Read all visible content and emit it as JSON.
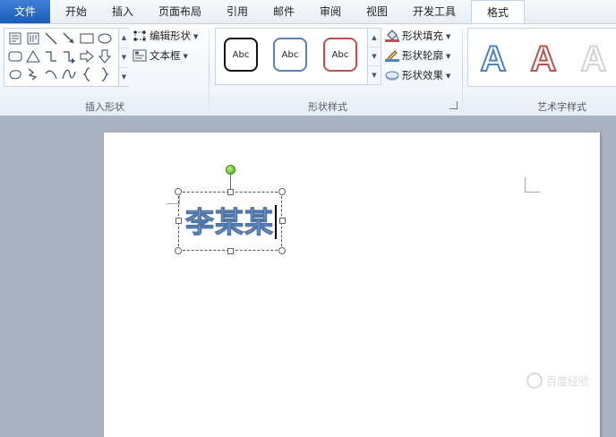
{
  "tabs": {
    "file": "文件",
    "items": [
      "开始",
      "插入",
      "页面布局",
      "引用",
      "邮件",
      "审阅",
      "视图",
      "开发工具"
    ],
    "active": "格式"
  },
  "ribbon": {
    "insert_shapes": {
      "label": "插入形状",
      "edit_shape": "编辑形状",
      "text_box": "文本框"
    },
    "shape_styles": {
      "label": "形状样式",
      "samples": [
        "Abc",
        "Abc",
        "Abc"
      ],
      "sample_colors": [
        "#111111",
        "#5b82b8",
        "#c0504d"
      ],
      "fill": "形状填充",
      "outline": "形状轮廓",
      "effects": "形状效果"
    },
    "wordart_styles": {
      "label": "艺术字样式",
      "samples": [
        "A",
        "A",
        "A"
      ],
      "sample_colors": [
        "#4f81bd",
        "#c0504d",
        "#d9d9d9"
      ]
    }
  },
  "document": {
    "textbox_text": "李某某",
    "watermark": "百度经验"
  }
}
